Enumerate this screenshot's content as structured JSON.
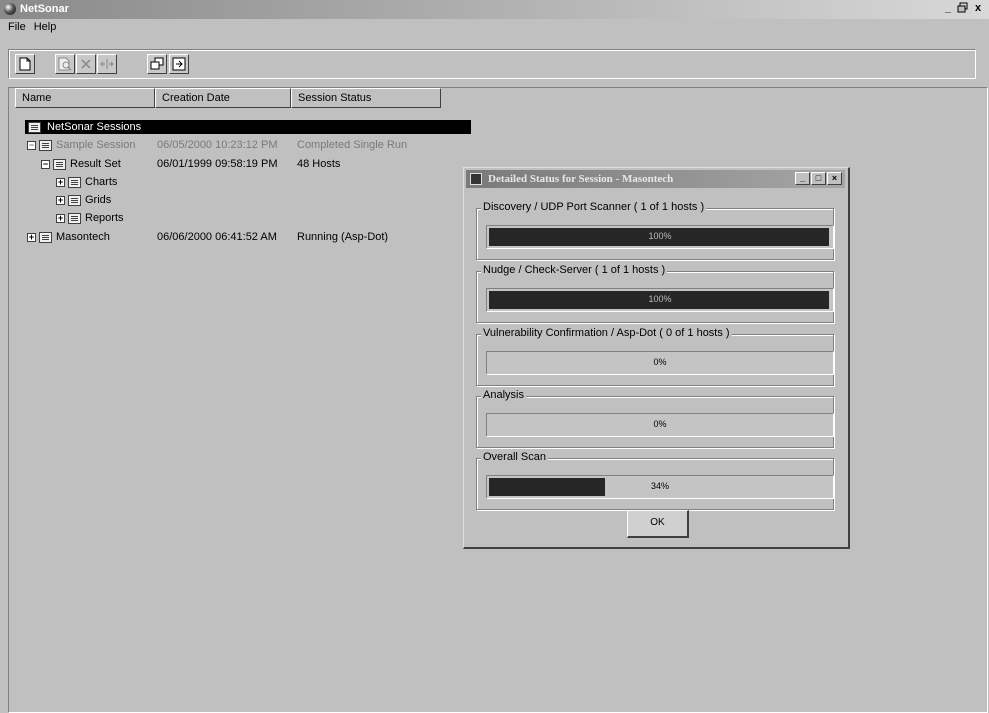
{
  "window": {
    "title": "NetSonar",
    "controls": [
      "_",
      "Ɛ",
      "x"
    ]
  },
  "menu": [
    "File",
    "Help"
  ],
  "toolbar": {
    "buttons": [
      "new-session",
      "open-session",
      "delete",
      "properties",
      "import",
      "export"
    ]
  },
  "columns": [
    "Name",
    "Creation Date",
    "Session Status"
  ],
  "tree": {
    "root_label": "NetSonar Sessions",
    "nodes": [
      {
        "label": "Sample Session",
        "date": "06/05/2000 10:23:12 PM",
        "status": "Completed Single Run"
      },
      {
        "label": "Result Set",
        "date": "06/01/1999 09:58:19 PM",
        "status": "48 Hosts"
      },
      {
        "label": "Charts"
      },
      {
        "label": "Grids"
      },
      {
        "label": "Reports"
      },
      {
        "label": "Masontech",
        "date": "06/06/2000 06:41:52 AM",
        "status": "Running (Asp-Dot)"
      }
    ]
  },
  "dialog": {
    "title": "Detailed Status for Session - Masontech",
    "groups": [
      {
        "label": "Discovery / UDP Port Scanner ( 1 of 1 hosts )",
        "text": "100%",
        "progress": 1.0
      },
      {
        "label": "Nudge / Check-Server ( 1 of 1 hosts )",
        "text": "100%",
        "progress": 1.0
      },
      {
        "label": "Vulnerability Confirmation / Asp-Dot ( 0 of 1 hosts )",
        "text": "0%",
        "progress": 0.0
      },
      {
        "label": "Analysis",
        "text": "0%",
        "progress": 0.0
      },
      {
        "label": "Overall Scan",
        "text": "34%",
        "progress": 0.34
      }
    ],
    "ok_label": "OK"
  }
}
